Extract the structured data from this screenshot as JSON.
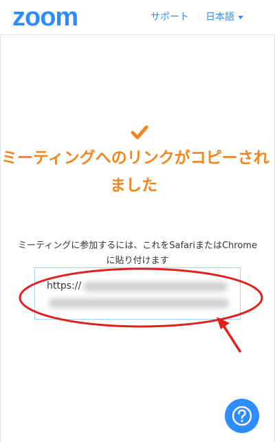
{
  "header": {
    "logo": "zoom",
    "support_label": "サポート",
    "language_label": "日本語"
  },
  "main": {
    "title_line1": "ミーティングへのリンクがコピーされ",
    "title_line2": "ました",
    "instruction_line1": "ミーティングに参加するには、これをSafariまたはChrome",
    "instruction_line2": "に貼り付けます",
    "link_prefix": "https://"
  },
  "colors": {
    "brand": "#2d8cff",
    "accent": "#f5841f",
    "annotation": "#e0201c"
  },
  "icons": {
    "check": "check-icon",
    "help": "question-icon",
    "caret": "caret-down-icon"
  }
}
